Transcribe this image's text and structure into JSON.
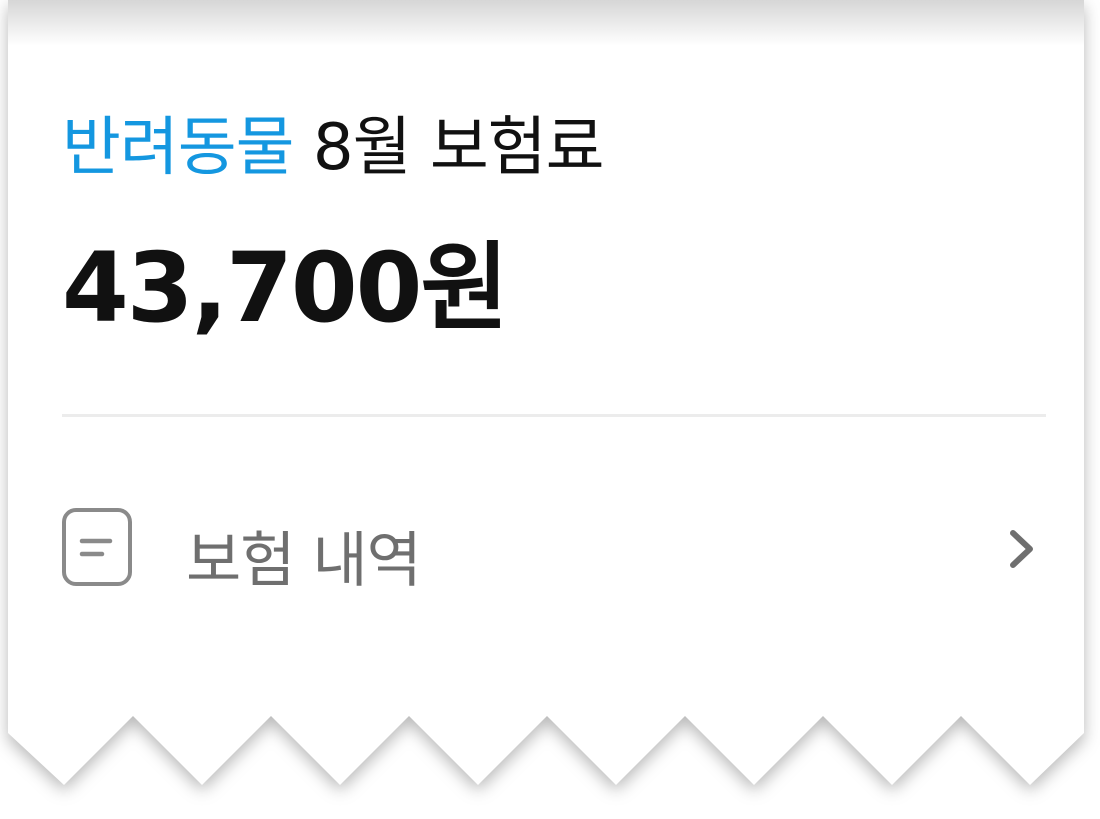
{
  "header": {
    "title_accent": "반려동물",
    "title_rest": " 8월 보험료",
    "amount": "43,700원"
  },
  "history_row": {
    "label": "보험 내역",
    "icon": "document-icon",
    "chevron": "chevron-right-icon"
  },
  "colors": {
    "accent": "#1497e0",
    "text": "#111111",
    "muted": "#6f6f6f",
    "divider": "#ececec"
  }
}
